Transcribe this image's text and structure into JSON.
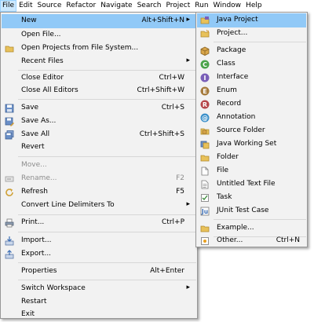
{
  "menubar": {
    "items": [
      "File",
      "Edit",
      "Source",
      "Refactor",
      "Navigate",
      "Search",
      "Project",
      "Run",
      "Window",
      "Help"
    ]
  },
  "file_menu": {
    "items": [
      {
        "label": "New",
        "shortcut": "Alt+Shift+N",
        "submenu": true,
        "highlighted": true,
        "icon": "none"
      },
      {
        "label": "Open File...",
        "shortcut": "",
        "icon": "none"
      },
      {
        "label": "Open Projects from File System...",
        "shortcut": "",
        "icon": "folder-icon"
      },
      {
        "label": "Recent Files",
        "shortcut": "",
        "submenu": true,
        "icon": "none"
      },
      {
        "label": "Close Editor",
        "shortcut": "Ctrl+W",
        "icon": "none"
      },
      {
        "label": "Close All Editors",
        "shortcut": "Ctrl+Shift+W",
        "icon": "none"
      },
      {
        "label": "Save",
        "shortcut": "Ctrl+S",
        "icon": "save-icon"
      },
      {
        "label": "Save As...",
        "shortcut": "",
        "icon": "save-as-icon"
      },
      {
        "label": "Save All",
        "shortcut": "Ctrl+Shift+S",
        "icon": "save-all-icon"
      },
      {
        "label": "Revert",
        "shortcut": "",
        "icon": "none"
      },
      {
        "label": "Move...",
        "shortcut": "",
        "disabled": true,
        "icon": "none"
      },
      {
        "label": "Rename...",
        "shortcut": "F2",
        "disabled": true,
        "icon": "rename-icon"
      },
      {
        "label": "Refresh",
        "shortcut": "F5",
        "icon": "refresh-icon"
      },
      {
        "label": "Convert Line Delimiters To",
        "shortcut": "",
        "submenu": true,
        "icon": "none"
      },
      {
        "label": "Print...",
        "shortcut": "Ctrl+P",
        "icon": "print-icon"
      },
      {
        "label": "Import...",
        "shortcut": "",
        "icon": "import-icon"
      },
      {
        "label": "Export...",
        "shortcut": "",
        "icon": "export-icon"
      },
      {
        "label": "Properties",
        "shortcut": "Alt+Enter",
        "icon": "none"
      },
      {
        "label": "Switch Workspace",
        "shortcut": "",
        "submenu": true,
        "icon": "none"
      },
      {
        "label": "Restart",
        "shortcut": "",
        "icon": "none"
      },
      {
        "label": "Exit",
        "shortcut": "",
        "icon": "none"
      }
    ]
  },
  "new_menu": {
    "items": [
      {
        "label": "Java Project",
        "shortcut": "",
        "highlighted": true,
        "icon": "java-project-icon"
      },
      {
        "label": "Project...",
        "shortcut": "",
        "icon": "project-icon"
      },
      {
        "label": "Package",
        "shortcut": "",
        "icon": "package-icon"
      },
      {
        "label": "Class",
        "shortcut": "",
        "icon": "class-icon"
      },
      {
        "label": "Interface",
        "shortcut": "",
        "icon": "interface-icon"
      },
      {
        "label": "Enum",
        "shortcut": "",
        "icon": "enum-icon"
      },
      {
        "label": "Record",
        "shortcut": "",
        "icon": "record-icon"
      },
      {
        "label": "Annotation",
        "shortcut": "",
        "icon": "annotation-icon"
      },
      {
        "label": "Source Folder",
        "shortcut": "",
        "icon": "source-folder-icon"
      },
      {
        "label": "Java Working Set",
        "shortcut": "",
        "icon": "working-set-icon"
      },
      {
        "label": "Folder",
        "shortcut": "",
        "icon": "folder-icon"
      },
      {
        "label": "File",
        "shortcut": "",
        "icon": "file-icon"
      },
      {
        "label": "Untitled Text File",
        "shortcut": "",
        "icon": "text-file-icon"
      },
      {
        "label": "Task",
        "shortcut": "",
        "icon": "task-icon"
      },
      {
        "label": "JUnit Test Case",
        "shortcut": "",
        "icon": "junit-icon"
      },
      {
        "label": "Example...",
        "shortcut": "",
        "icon": "example-icon"
      },
      {
        "label": "Other...",
        "shortcut": "Ctrl+N",
        "icon": "other-icon"
      }
    ]
  },
  "colors": {
    "menu_bg": "#f2f2f2",
    "highlight": "#91c9f7",
    "menubar_active": "#cce8ff",
    "disabled_text": "#8d8d8d"
  }
}
